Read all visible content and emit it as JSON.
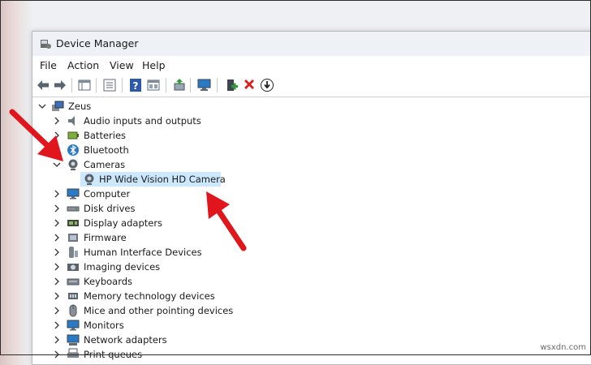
{
  "window": {
    "title": "Device Manager"
  },
  "menu": [
    "File",
    "Action",
    "View",
    "Help"
  ],
  "toolbar": [
    {
      "icon": "back-arrow-icon"
    },
    {
      "icon": "forward-arrow-icon"
    },
    {
      "icon": "properties-pane-icon"
    },
    {
      "icon": "show-hidden-icon"
    },
    {
      "icon": "help-icon"
    },
    {
      "icon": "device-list-icon"
    },
    {
      "icon": "update-driver-icon"
    },
    {
      "icon": "scan-hardware-icon"
    },
    {
      "icon": "add-legacy-hardware-icon"
    },
    {
      "icon": "uninstall-device-icon"
    },
    {
      "icon": "download-driver-icon"
    }
  ],
  "tree": {
    "root": {
      "label": "Zeus",
      "expanded": true
    },
    "categories": [
      {
        "label": "Audio inputs and outputs",
        "icon": "speaker-icon",
        "expanded": false
      },
      {
        "label": "Batteries",
        "icon": "battery-icon",
        "expanded": false
      },
      {
        "label": "Bluetooth",
        "icon": "bluetooth-icon",
        "expanded": false
      },
      {
        "label": "Cameras",
        "icon": "camera-icon",
        "expanded": true
      },
      {
        "label": "Computer",
        "icon": "monitor-icon",
        "expanded": false
      },
      {
        "label": "Disk drives",
        "icon": "disk-drive-icon",
        "expanded": false
      },
      {
        "label": "Display adapters",
        "icon": "display-adapter-icon",
        "expanded": false
      },
      {
        "label": "Firmware",
        "icon": "firmware-icon",
        "expanded": false
      },
      {
        "label": "Human Interface Devices",
        "icon": "hid-icon",
        "expanded": false
      },
      {
        "label": "Imaging devices",
        "icon": "imaging-icon",
        "expanded": false
      },
      {
        "label": "Keyboards",
        "icon": "keyboard-icon",
        "expanded": false
      },
      {
        "label": "Memory technology devices",
        "icon": "memory-icon",
        "expanded": false
      },
      {
        "label": "Mice and other pointing devices",
        "icon": "mouse-icon",
        "expanded": false
      },
      {
        "label": "Monitors",
        "icon": "monitor-icon",
        "expanded": false
      },
      {
        "label": "Network adapters",
        "icon": "network-adapter-icon",
        "expanded": false
      },
      {
        "label": "Print queues",
        "icon": "printer-icon",
        "expanded": false
      }
    ],
    "camera_device": {
      "label": "HP Wide Vision HD Camera",
      "icon": "webcam-icon",
      "selected": true
    }
  },
  "colors": {
    "selection": "#cce8ff",
    "annotation_arrow": "#e0161c"
  },
  "watermark": "wsxdn.com"
}
